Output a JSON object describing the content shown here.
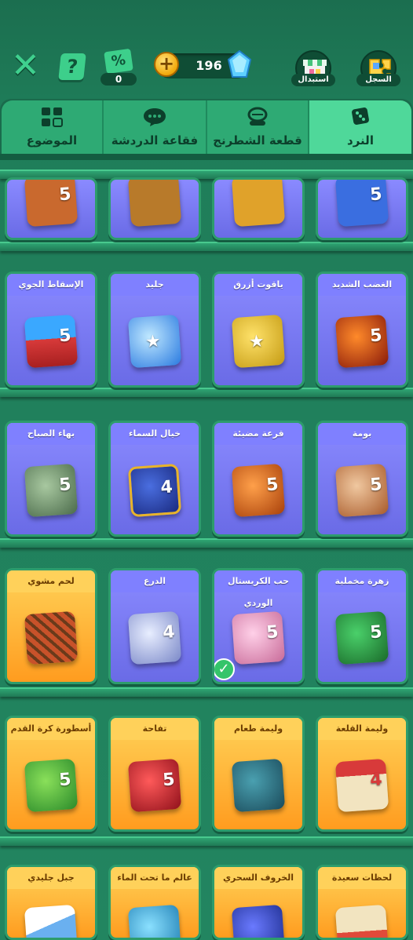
{
  "header": {
    "discount_count": "0",
    "discount_symbol": "%",
    "coin_amount": "196",
    "coin_symbol": "+",
    "help_symbol": "?",
    "close_symbol": "✕",
    "exchange_label": "استبدال",
    "history_label": "السجل"
  },
  "tabs": [
    {
      "label": "النرد",
      "icon": "dice-icon",
      "active": true
    },
    {
      "label": "قطعة الشطرنج",
      "icon": "chess-piece-icon",
      "active": false
    },
    {
      "label": "فقاعة الدردشة",
      "icon": "chat-bubble-icon",
      "active": false
    },
    {
      "label": "الموضوع",
      "icon": "theme-grid-icon",
      "active": false
    }
  ],
  "rows": [
    {
      "items": [
        {
          "title": "",
          "color": "#c9692e"
        },
        {
          "title": "",
          "color": "#b87a2a"
        },
        {
          "title": "",
          "color": "#e0a22a"
        },
        {
          "title": "",
          "color": "#3a6ee0"
        }
      ]
    },
    {
      "items": [
        {
          "title": "الغضب الشديد",
          "color": "#c84a1a"
        },
        {
          "title": "ياقوت أزرق",
          "color": "#e6c22e"
        },
        {
          "title": "جليد",
          "color": "#3fa8ff"
        },
        {
          "title": "الإسقاط الجوي",
          "color": "#d83a3a"
        }
      ]
    },
    {
      "items": [
        {
          "title": "بومة",
          "color": "#d98a55"
        },
        {
          "title": "قرعة مضيئة",
          "color": "#e06a2a"
        },
        {
          "title": "خيال السماء",
          "color": "#2a4db8"
        },
        {
          "title": "بهاء الصباح",
          "color": "#6a8a6a"
        }
      ]
    },
    {
      "items": [
        {
          "title": "زهرة مخملية",
          "color": "#2e9a4a"
        },
        {
          "title": "حب الكريستال الوردي",
          "color": "#e08ab8"
        },
        {
          "title": "الدرع",
          "color": "#a8b4e0"
        },
        {
          "title": "لحم مشوي",
          "color": "#c8522a"
        }
      ]
    },
    {
      "items": [
        {
          "title": "وليمة القلعة",
          "color": "#e8d6a8"
        },
        {
          "title": "وليمة طعام",
          "color": "#2a6a7a"
        },
        {
          "title": "تفاحة",
          "color": "#d02a3a"
        },
        {
          "title": "أسطورة كرة القدم",
          "color": "#4ab83a"
        }
      ]
    },
    {
      "items": [
        {
          "title": "لحظات سعيدة",
          "color": "#e04a3a"
        },
        {
          "title": "الخروف السحري",
          "color": "#3a4ad0"
        },
        {
          "title": "عالم ما تحت الماء",
          "color": "#3ab0e0"
        },
        {
          "title": "جبل جليدي",
          "color": "#6ab0f0"
        }
      ]
    }
  ],
  "die_faces": {
    "number": "5",
    "pips": "4"
  },
  "check_symbol": "✓"
}
